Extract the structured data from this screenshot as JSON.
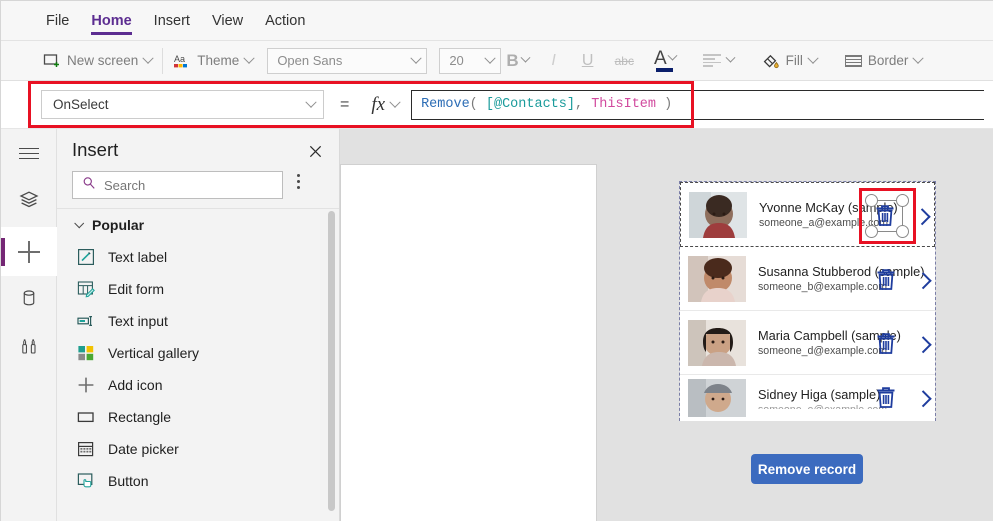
{
  "menubar": {
    "items": [
      {
        "label": "File",
        "active": false
      },
      {
        "label": "Home",
        "active": true
      },
      {
        "label": "Insert",
        "active": false
      },
      {
        "label": "View",
        "active": false
      },
      {
        "label": "Action",
        "active": false
      }
    ]
  },
  "ribbon": {
    "new_screen": "New screen",
    "theme": "Theme",
    "font_family": "Open Sans",
    "font_size": "20",
    "bold": "B",
    "italic": "I",
    "underline": "U",
    "strikethrough": "abc",
    "font_color": "A",
    "fill": "Fill",
    "border": "Border"
  },
  "formula_bar": {
    "property": "OnSelect",
    "equals": "=",
    "fx": "fx",
    "formula_tokens": [
      {
        "text": "Remove",
        "type": "fn"
      },
      {
        "text": "( ",
        "type": "pn"
      },
      {
        "text": "[@Contacts]",
        "type": "tbl"
      },
      {
        "text": ", ",
        "type": "pn"
      },
      {
        "text": "ThisItem",
        "type": "var"
      },
      {
        "text": " )",
        "type": "pn"
      }
    ],
    "formula_text": "Remove( [@Contacts], ThisItem )"
  },
  "rail": {
    "items": [
      {
        "name": "menu-icon",
        "selected": false
      },
      {
        "name": "tree-view-icon",
        "selected": false
      },
      {
        "name": "insert-icon",
        "selected": true
      },
      {
        "name": "data-icon",
        "selected": false
      },
      {
        "name": "media-icon",
        "selected": false
      }
    ]
  },
  "insert_panel": {
    "title": "Insert",
    "close_label": "✕",
    "search_placeholder": "Search",
    "group": {
      "label": "Popular",
      "expanded": true
    },
    "items": [
      {
        "label": "Text label",
        "icon": "text-label-icon"
      },
      {
        "label": "Edit form",
        "icon": "edit-form-icon"
      },
      {
        "label": "Text input",
        "icon": "text-input-icon"
      },
      {
        "label": "Vertical gallery",
        "icon": "vertical-gallery-icon"
      },
      {
        "label": "Add icon",
        "icon": "add-icon"
      },
      {
        "label": "Rectangle",
        "icon": "rectangle-icon"
      },
      {
        "label": "Date picker",
        "icon": "date-picker-icon"
      },
      {
        "label": "Button",
        "icon": "button-icon"
      }
    ]
  },
  "gallery": {
    "rows": [
      {
        "name": "Yvonne McKay (sample)",
        "email": "someone_a@example.com",
        "selected": true,
        "avatar_from": "#8f6f5d",
        "avatar_to": "#c9b7a6"
      },
      {
        "name": "Susanna Stubberod (sample)",
        "email": "someone_b@example.com",
        "selected": false,
        "avatar_from": "#7a4b3a",
        "avatar_to": "#ddc3b2"
      },
      {
        "name": "Maria Campbell (sample)",
        "email": "someone_d@example.com",
        "selected": false,
        "avatar_from": "#3a2e2a",
        "avatar_to": "#d6c2b4"
      },
      {
        "name": "Sidney Higa (sample)",
        "email": "someone_e@example.com",
        "selected": false,
        "avatar_from": "#6b6f75",
        "avatar_to": "#c3c8cc"
      }
    ],
    "remove_button": "Remove record"
  },
  "colors": {
    "accent_purple": "#5c2d91",
    "annotation_red": "#e81123",
    "button_blue": "#3c6bbf",
    "icon_blue": "#1f3d9e",
    "canvas_gray": "#e1e1e1",
    "panel_gray": "#f3f3f3"
  }
}
